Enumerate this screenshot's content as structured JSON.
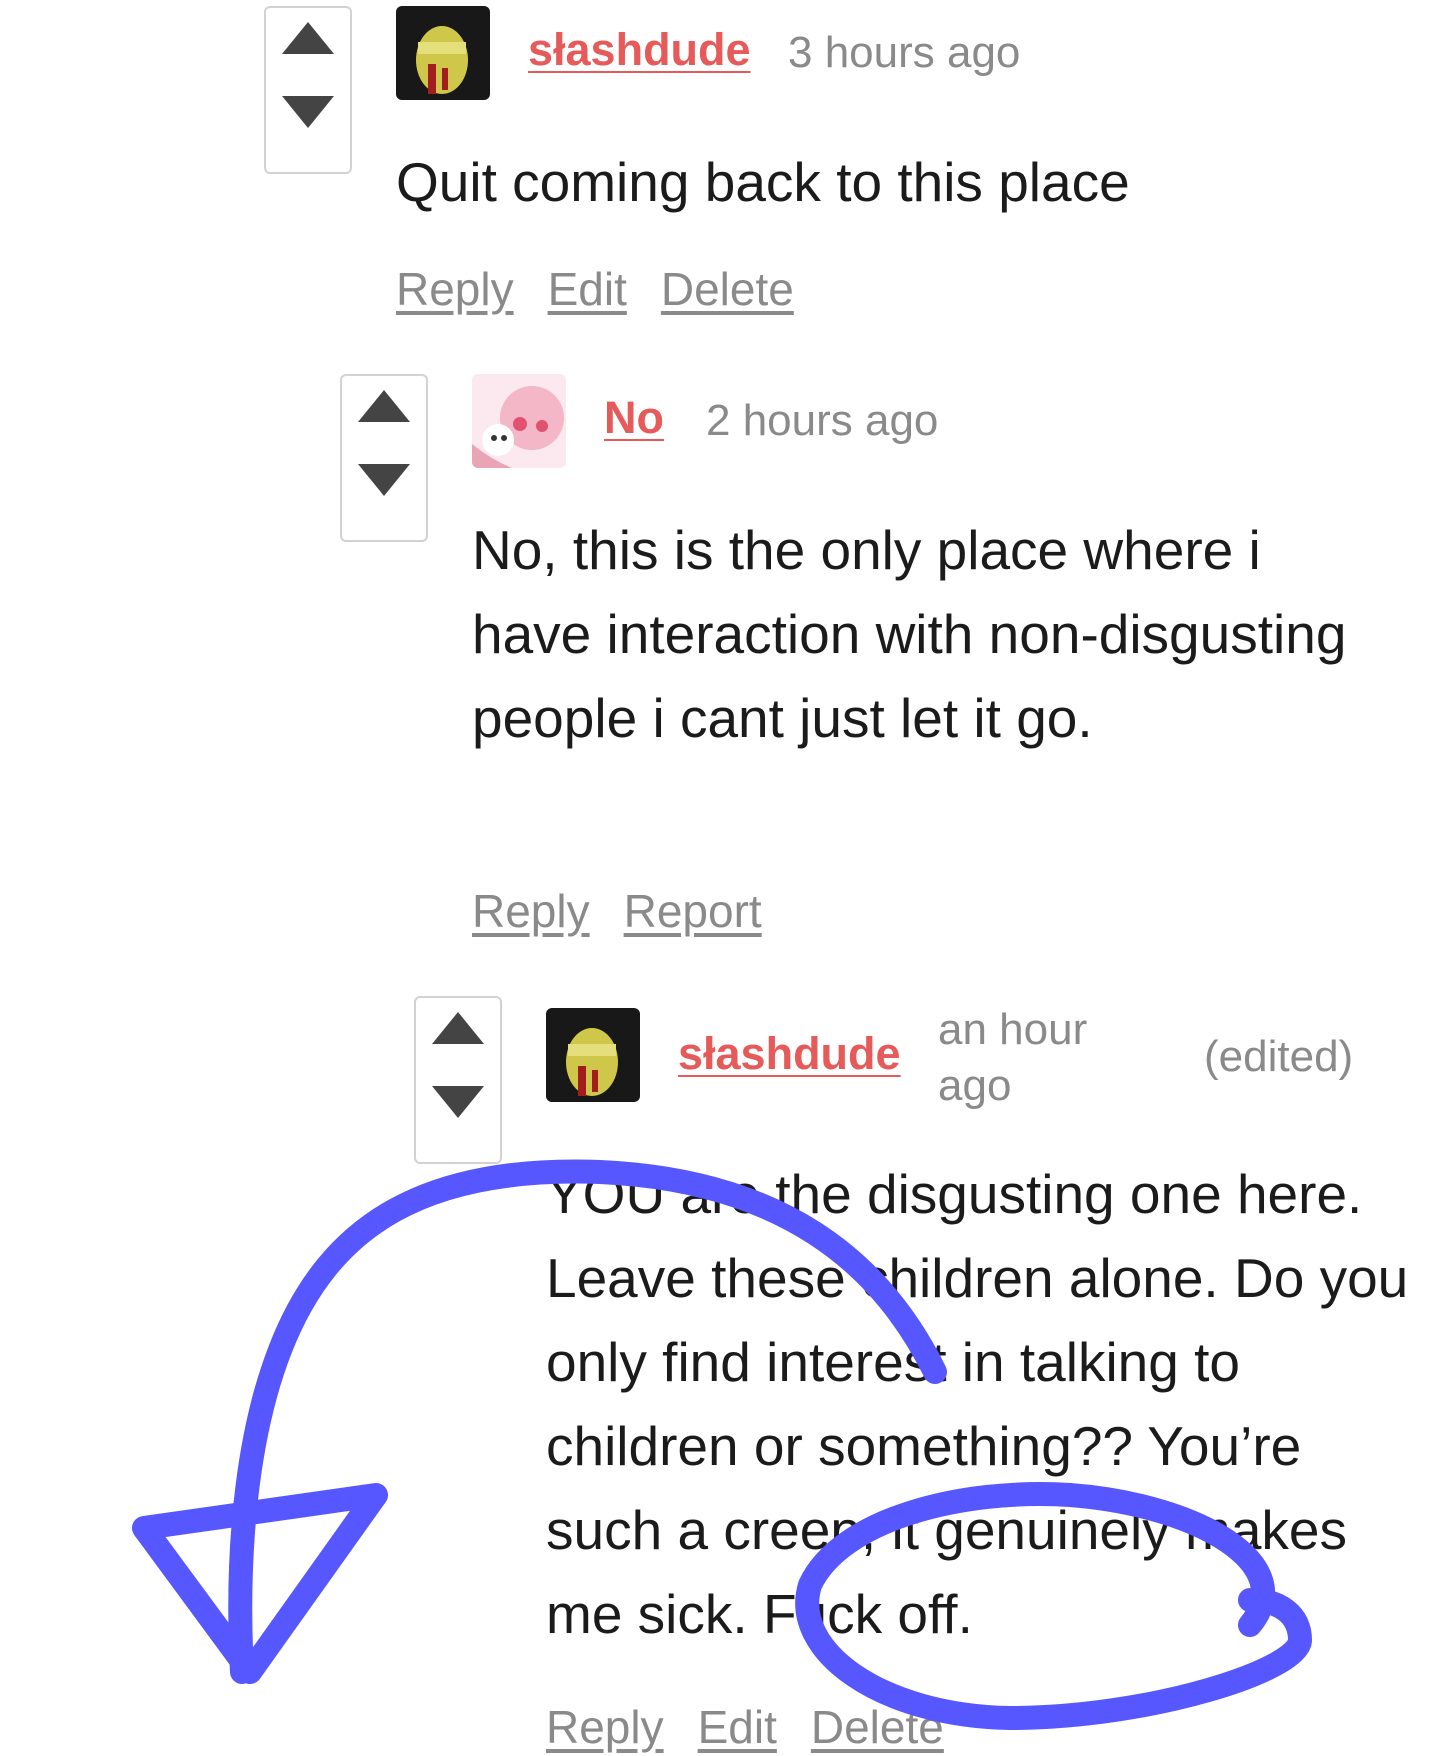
{
  "comments": [
    {
      "username": "słashdude",
      "time": "3 hours ago",
      "text": "Quit coming back to this place",
      "actions": [
        "Reply",
        "Edit",
        "Delete"
      ]
    },
    {
      "username": "No",
      "time": "2 hours ago",
      "text": "No, this is the only place where i have interaction with non-disgusting people i cant just let it go.",
      "actions": [
        "Reply",
        "Report"
      ]
    },
    {
      "username": "słashdude",
      "time": "an hour ago",
      "edited": "(edited)",
      "text": "YOU are the disgusting one here. Leave these children alone. Do you only find interest in talking to children or something?? You’re such a creep, it genuinely makes me sick. Fuck off.",
      "actions": [
        "Reply",
        "Edit",
        "Delete"
      ]
    }
  ],
  "colors": {
    "username": "#e65a5a",
    "muted": "#8a8a8a",
    "annotation": "#5757ff"
  }
}
